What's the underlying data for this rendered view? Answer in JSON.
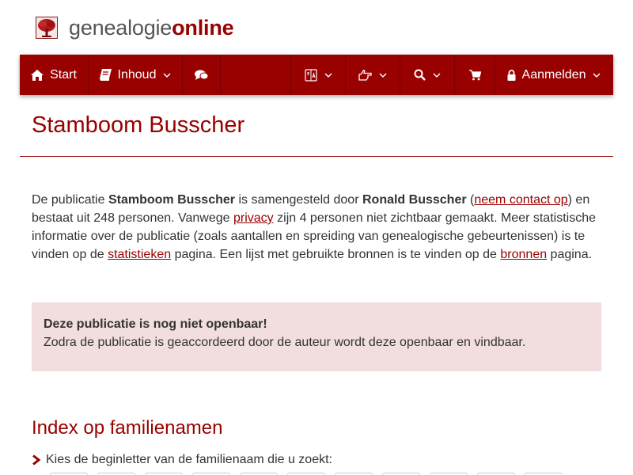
{
  "brand": {
    "part1": "genealogie",
    "part2": "online"
  },
  "nav": {
    "start": "Start",
    "inhoud": "Inhoud",
    "aanmelden": "Aanmelden"
  },
  "page": {
    "title": "Stamboom Busscher",
    "intro": {
      "t1": "De publicatie ",
      "pub_name": "Stamboom Busscher",
      "t2": " is samengesteld door ",
      "author": "Ronald Busscher",
      "t3": " (",
      "contact_link": "neem contact op",
      "t4": ") en bestaat uit 248 personen. Vanwege ",
      "privacy_link": "privacy",
      "t5": " zijn 4 personen niet zichtbaar gemaakt. Meer statistische informatie over de publicatie (zoals aantallen en spreiding van genealogische gebeurtenissen) is te vinden op de ",
      "stats_link": "statistieken",
      "t6": " pagina. Een lijst met gebruikte bronnen is te vinden op de ",
      "sources_link": "bronnen",
      "t7": " pagina."
    },
    "alert": {
      "title": "Deze publicatie is nog niet openbaar!",
      "body": "Zodra de publicatie is geaccordeerd door de auteur wordt deze openbaar en vindbaar."
    },
    "index": {
      "heading": "Index op familienamen",
      "hint": "Kies de beginletter van de familienaam die u zoekt:"
    }
  },
  "colors": {
    "brand": "#990000",
    "alert_bg": "#f2dede",
    "text": "#333333"
  },
  "icons": [
    "tree-logo-icon",
    "home-icon",
    "book-icon",
    "comments-icon",
    "language-icon",
    "hand-point-icon",
    "search-icon",
    "cart-icon",
    "lock-icon",
    "chevron-down-icon",
    "chevron-right-icon"
  ]
}
